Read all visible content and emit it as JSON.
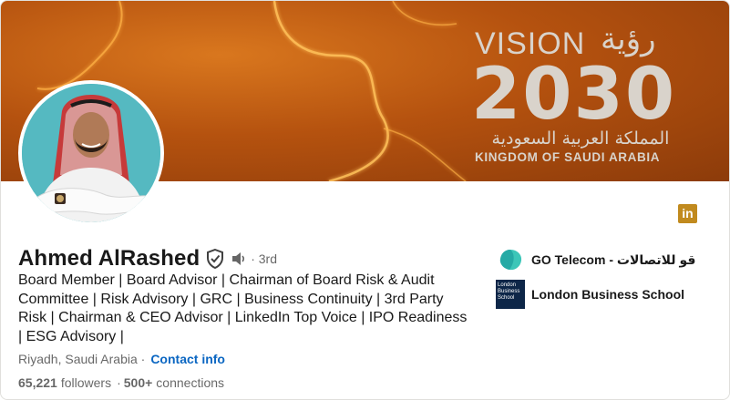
{
  "profile": {
    "name": "Ahmed AlRashed",
    "degree": "· 3rd",
    "headline": "Board Member | Board Advisor | Chairman of Board Risk & Audit Committee | Risk Advisory | GRC | Business Continuity | 3rd Party Risk | Chairman & CEO Advisor | LinkedIn Top Voice | IPO Readiness | ESG Advisory |",
    "location": "Riyadh, Saudi Arabia ·",
    "contact_label": "Contact info",
    "followers_count": "65,221",
    "followers_label": "followers",
    "connections_sep": "·",
    "connections": "500+",
    "connections_label": "connections"
  },
  "banner": {
    "vision_word": "VISION",
    "vision_arabic": "رؤية",
    "year": "2030",
    "arabic_kingdom": "المملكة العربية السعودية",
    "kingdom": "KINGDOM OF SAUDI ARABIA"
  },
  "badge": {
    "linkedin_label": "in"
  },
  "organizations": [
    {
      "name": "GO Telecom - قو للاتصالات",
      "icon": "go-telecom-logo"
    },
    {
      "name": "London Business School",
      "icon": "lbs-logo",
      "logo_text": "London Business School"
    }
  ],
  "colors": {
    "link": "#0a66c2",
    "banner_orange": "#c0601a",
    "linkedin_badge": "#c18a1e",
    "lbs_navy": "#0d2648",
    "go_teal": "#3cc6b8"
  }
}
